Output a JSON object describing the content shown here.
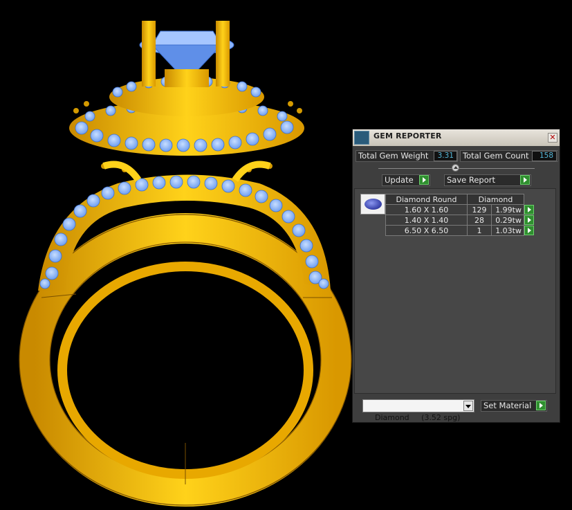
{
  "panel": {
    "title": "GEM REPORTER",
    "close_icon": "close-icon",
    "total_weight_label": "Total Gem Weight",
    "total_weight_value": "3.31",
    "total_count_label": "Total Gem Count",
    "total_count_value": "158",
    "update_label": "Update",
    "save_report_label": "Save Report",
    "table": {
      "headers": [
        "Diamond Round",
        "Diamond"
      ],
      "rows": [
        {
          "size": "1.60 X 1.60",
          "count": "129",
          "weight": "1.99tw"
        },
        {
          "size": "1.40 X 1.40",
          "count": "28",
          "weight": "0.29tw"
        },
        {
          "size": "6.50 X 6.50",
          "count": "1",
          "weight": "1.03tw"
        }
      ]
    },
    "material_select": "Diamond     (3.52 spg)",
    "set_material_label": "Set Material"
  },
  "colors": {
    "gold": "#f2b400",
    "gem_blue": "#86b4ff",
    "value_text": "#55b7d8",
    "play_green": "#2f8f2f"
  }
}
